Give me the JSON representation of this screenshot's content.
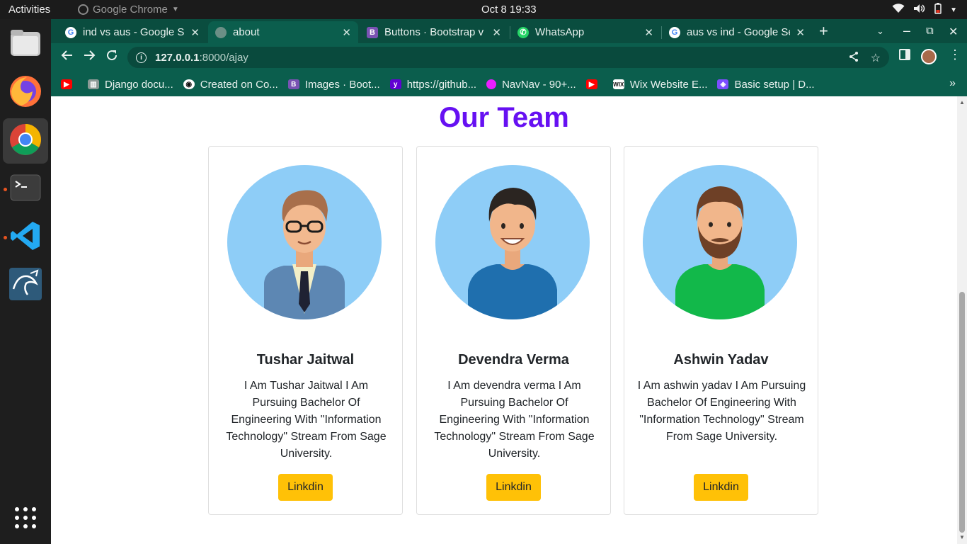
{
  "system": {
    "activities": "Activities",
    "app_name": "Google Chrome",
    "clock": "Oct 8  19:33"
  },
  "browser": {
    "tabs": [
      {
        "title": "ind vs aus - Google Se",
        "icon": "google-icon",
        "active": false
      },
      {
        "title": "about",
        "icon": "globe-icon",
        "active": true
      },
      {
        "title": "Buttons · Bootstrap v",
        "icon": "bootstrap-icon",
        "active": false
      },
      {
        "title": "WhatsApp",
        "icon": "whatsapp-icon",
        "active": false
      },
      {
        "title": "aus vs ind - Google Se",
        "icon": "google-icon",
        "active": false
      }
    ],
    "new_tab": "+",
    "url_host": "127.0.0.1",
    "url_path": ":8000/ajay",
    "bookmarks": [
      {
        "label": "",
        "icon": "youtube-icon"
      },
      {
        "label": "Django docu...",
        "icon": "django-icon"
      },
      {
        "label": "Created on Co...",
        "icon": "github-icon"
      },
      {
        "label": "Images · Boot...",
        "icon": "bootstrap-icon"
      },
      {
        "label": "https://github...",
        "icon": "yahoo-icon"
      },
      {
        "label": "NavNav - 90+...",
        "icon": "navnav-icon"
      },
      {
        "label": "",
        "icon": "youtube-icon"
      },
      {
        "label": "Wix Website E...",
        "icon": "wix-icon"
      },
      {
        "label": "Basic setup | D...",
        "icon": "setup-icon"
      }
    ],
    "bookmarks_more": "»"
  },
  "page": {
    "title": "Our Team",
    "members": [
      {
        "name": "Tushar Jaitwal",
        "description": "I Am Tushar Jaitwal I Am Pursuing Bachelor Of Engineering With \"Information Technology\" Stream From Sage University.",
        "button": "Linkdin"
      },
      {
        "name": "Devendra Verma",
        "description": "I Am devendra verma I Am Pursuing Bachelor Of Engineering With \"Information Technology\" Stream From Sage University.",
        "button": "Linkdin"
      },
      {
        "name": "Ashwin Yadav",
        "description": "I Am ashwin yadav I Am Pursuing Bachelor Of Engineering With \"Information Technology\" Stream From Sage University.",
        "button": "Linkdin"
      }
    ]
  },
  "colors": {
    "title": "#6610f2",
    "button": "#ffc107",
    "chrome_theme": "#0b5e4d",
    "avatar_bg": "#8ecdf7"
  }
}
